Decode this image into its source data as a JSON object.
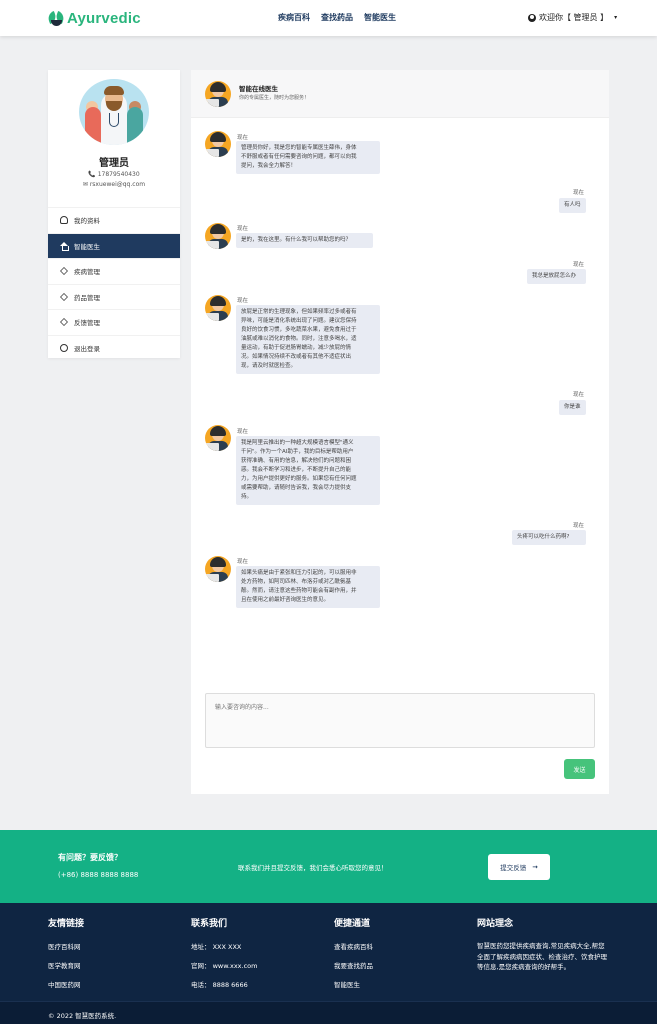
{
  "brand": {
    "logo_text": "Ayurvedic",
    "accent": "#2ab57d"
  },
  "nav": {
    "items": [
      "疾病百科",
      "查找药品",
      "智能医生"
    ]
  },
  "user_menu": {
    "label": "欢迎你【 管理员 】",
    "icon": "user-circle-icon",
    "caret": "▾"
  },
  "profile": {
    "name": "管理员",
    "phone": "📞 17879540430",
    "email": "✉ rsxuewei@qq.com"
  },
  "sidebar": {
    "items": [
      {
        "label": "我的资料",
        "icon": "person-icon",
        "active": false
      },
      {
        "label": "智能医生",
        "icon": "home-icon",
        "active": true
      },
      {
        "label": "疾病管理",
        "icon": "layers-icon",
        "active": false
      },
      {
        "label": "药品管理",
        "icon": "layers-icon",
        "active": false
      },
      {
        "label": "反馈管理",
        "icon": "layers-icon",
        "active": false
      },
      {
        "label": "退出登录",
        "icon": "power-icon",
        "active": false
      }
    ]
  },
  "chat": {
    "title": "智能在线医生",
    "subtitle": "你的专属医生，随时为您服务！",
    "messages": [
      {
        "from": "doctor",
        "time": "现在",
        "lines": [
          "管理员你好，我是您的智能专属医生薛伟，身体",
          "不舒服或者有任何需要咨询的问题，都可以向我",
          "提问，我会全力解答！"
        ]
      },
      {
        "from": "user",
        "time": "现在",
        "lines": [
          "有人吗"
        ]
      },
      {
        "from": "doctor",
        "time": "现在",
        "lines": [
          "是的，我在这里。有什么我可以帮助您的吗？"
        ]
      },
      {
        "from": "user",
        "time": "现在",
        "lines": [
          "我总是放屁怎么办"
        ]
      },
      {
        "from": "doctor",
        "time": "现在",
        "lines": [
          "放屁是正常的生理现象，但如果频率过多或者有",
          "异味，可能是消化系统出现了问题。建议您保持",
          "良好的饮食习惯，多吃蔬菜水果，避免食用过于",
          "油腻或难以消化的食物。同时，注意多喝水，适",
          "量运动，有助于促进肠胃蠕动，减少放屁的情",
          "况。如果情况持续不改或者有其他不适症状出",
          "现，请及时就医检查。"
        ]
      },
      {
        "from": "user",
        "time": "现在",
        "lines": [
          "你是谁"
        ]
      },
      {
        "from": "doctor",
        "time": "现在",
        "lines": [
          "我是阿里云推出的一种超大规模语言模型\"通义",
          "千问\"。作为一个AI助手，我的目标是帮助用户",
          "获得准确、有用的信息，解决他们的问题和困",
          "惑。我会不断学习和进步，不断提升自己的能",
          "力，为用户提供更好的服务。如果您有任何问题",
          "或需要帮助，请随时告诉我，我会尽力提供支",
          "持。"
        ]
      },
      {
        "from": "user",
        "time": "现在",
        "lines": [
          "头疼可以吃什么药啊?"
        ]
      },
      {
        "from": "doctor",
        "time": "现在",
        "lines": [
          "如果头痛是由于紧张和压力引起的，可以服用非",
          "处方药物，如阿司匹林、布洛芬或对乙酰氨基",
          "酚。然而，请注意这些药物可能会有副作用，并",
          "且在使用之前最好咨询医生的意见。"
        ]
      }
    ],
    "input_placeholder": "输入要咨询的内容...",
    "send_label": "发送"
  },
  "feedback_band": {
    "question": "有问题？要反馈？",
    "phone": "(+86) 8888 8888 8888",
    "message": "联系我们并且提交反馈，我们会悉心听取您的意见！",
    "button_label": "提交反馈",
    "button_arrow": "→",
    "color": "#14b185"
  },
  "footer": {
    "links": {
      "title": "友情链接",
      "items": [
        "医疗百科网",
        "医学教育网",
        "中国医药网"
      ]
    },
    "contact": {
      "title": "联系我们",
      "items": [
        "地址：  XXX XXX",
        "官网：  www.xxx.com",
        "电话：  8888 6666"
      ]
    },
    "quick": {
      "title": "便捷通道",
      "items": [
        "查看疾病百科",
        "我要查找药品",
        "智能医生"
      ]
    },
    "philosophy": {
      "title": "网站理念",
      "text": "智慧医药您提供疾病查询,常见疾病大全,帮您全面了解疾病病因症状、检查治疗、饮食护理等信息,是您疾病查询的好帮手。"
    },
    "copyright": "© 2022 智慧医药系统."
  }
}
